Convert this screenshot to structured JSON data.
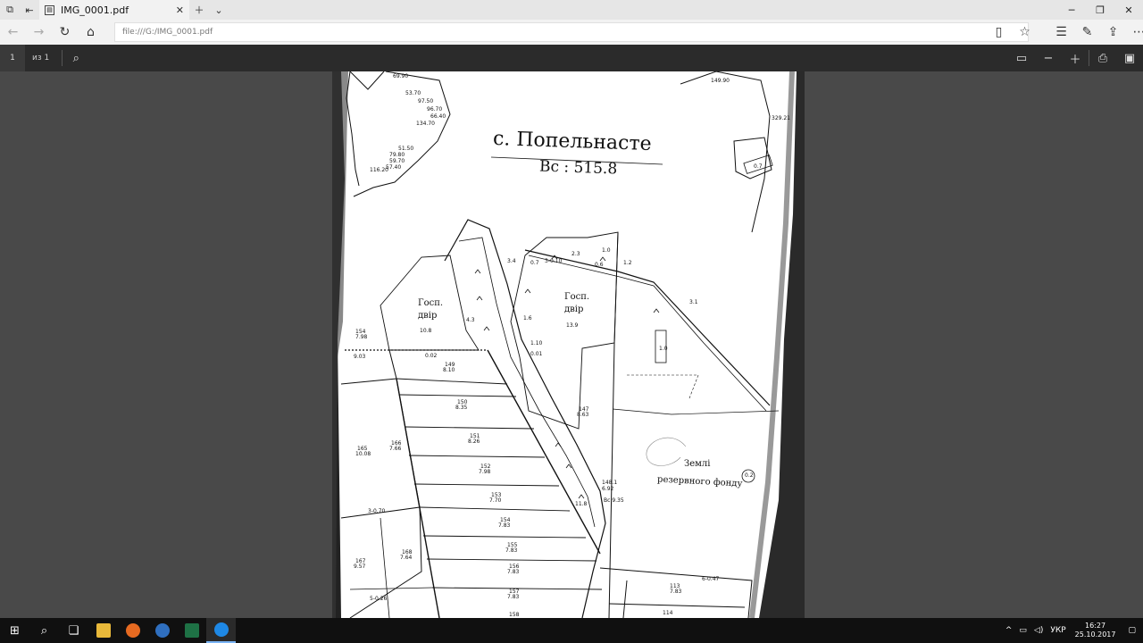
{
  "browser": {
    "tab_title": "IMG_0001.pdf",
    "address": "file:///G:/IMG_0001.pdf"
  },
  "pdf_toolbar": {
    "current_page": "1",
    "page_of": "из 1"
  },
  "map": {
    "title": "с. Попельнасте",
    "area": "Вс : 515.8",
    "labels": {
      "gosp1_a": "Госп.",
      "gosp1_b": "двір",
      "gosp1_n": "10.8",
      "gosp2_a": "Госп.",
      "gosp2_b": "двір",
      "gosp2_n": "13.9",
      "reserve_a": "Землі",
      "reserve_b": "резервного фонду",
      "reserve_n": "0.2"
    },
    "numbers": [
      "69.90",
      "53.70",
      "97.50",
      "96.70",
      "66.40",
      "134.70",
      "51.50",
      "79.80",
      "59.70",
      "57.40",
      "116.20",
      "149.90",
      "329.21",
      "0.7",
      "3.4",
      "0.7",
      "2.3",
      "1.0",
      "0.6",
      "1.2",
      "3.1",
      "1.0",
      "4.3",
      "1.6",
      "1.10",
      "0.01",
      "0.02",
      "154",
      "7.98",
      "9.03",
      "149",
      "8.10",
      "150",
      "8.35",
      "151",
      "8.26",
      "152",
      "7.98",
      "153",
      "7.70",
      "154",
      "7.83",
      "155",
      "7.83",
      "156",
      "7.83",
      "157",
      "7.83",
      "158",
      "165",
      "10.08",
      "166",
      "7.66",
      "167",
      "9.57",
      "168",
      "7.64",
      "147",
      "8.63",
      "148.1",
      "6.92",
      "Вс 9.35",
      "11.8",
      "113",
      "7.83",
      "114",
      "6-0.47",
      "3-0.70",
      "5-0.26",
      "3-0.10"
    ]
  },
  "taskbar": {
    "lang": "УКР",
    "time": "16:27",
    "date": "25.10.2017"
  }
}
